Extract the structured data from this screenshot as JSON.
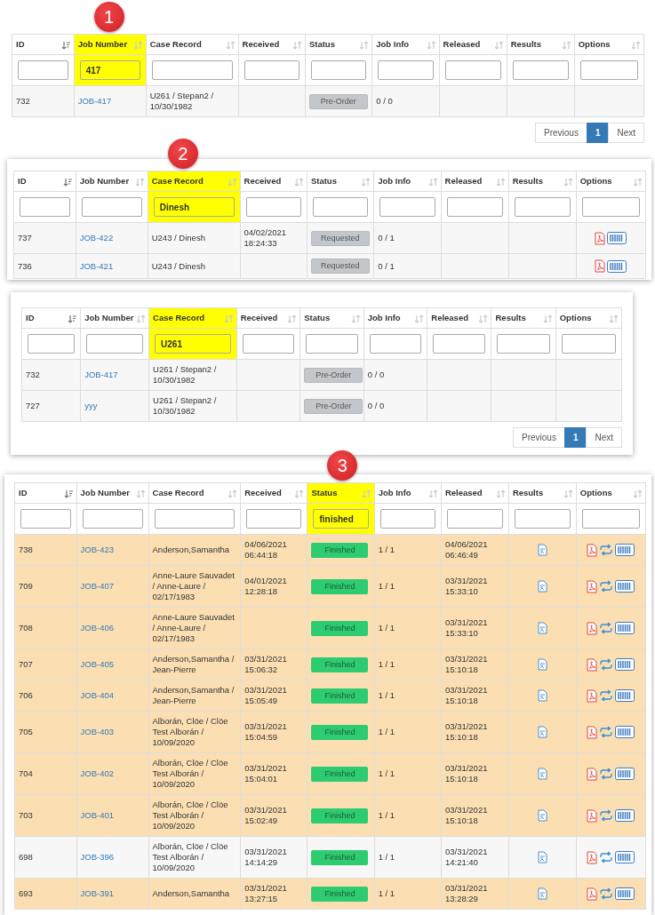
{
  "panels": [
    {
      "badge": "1",
      "columns": [
        {
          "label": "ID",
          "sorted": true,
          "highlighted": false
        },
        {
          "label": "Job Number",
          "sorted": false,
          "highlighted": true,
          "filter": "417"
        },
        {
          "label": "Case Record",
          "sorted": false,
          "highlighted": false
        },
        {
          "label": "Received",
          "sorted": false,
          "highlighted": false
        },
        {
          "label": "Status",
          "sorted": false,
          "highlighted": false
        },
        {
          "label": "Job Info",
          "sorted": false,
          "highlighted": false
        },
        {
          "label": "Released",
          "sorted": false,
          "highlighted": false
        },
        {
          "label": "Results",
          "sorted": false,
          "highlighted": false
        },
        {
          "label": "Options",
          "sorted": false,
          "highlighted": false
        }
      ],
      "rows": [
        {
          "id": "732",
          "job": "JOB-417",
          "case": "U261 / Stepan2 / 10/30/1982",
          "status": {
            "label": "Pre-Order",
            "kind": "pending"
          },
          "job_info": "0 / 0",
          "result_file": false,
          "highlighted": false
        }
      ],
      "pagination": [
        {
          "label": "Previous",
          "selected": false
        },
        {
          "label": "1",
          "selected": true
        },
        {
          "label": "Next",
          "selected": false
        }
      ]
    },
    {
      "badge": "2",
      "columns": [
        {
          "label": "ID",
          "sorted": true,
          "highlighted": false
        },
        {
          "label": "Job Number",
          "sorted": false,
          "highlighted": false
        },
        {
          "label": "Case Record",
          "sorted": false,
          "highlighted": true,
          "filter": "Dinesh"
        },
        {
          "label": "Received",
          "sorted": false,
          "highlighted": false
        },
        {
          "label": "Status",
          "sorted": false,
          "highlighted": false
        },
        {
          "label": "Job Info",
          "sorted": false,
          "highlighted": false
        },
        {
          "label": "Released",
          "sorted": false,
          "highlighted": false
        },
        {
          "label": "Results",
          "sorted": false,
          "highlighted": false
        },
        {
          "label": "Options",
          "sorted": false,
          "highlighted": false
        }
      ],
      "rows": [
        {
          "id": "737",
          "job": "JOB-422",
          "case": "U243 / Dinesh",
          "received": "04/02/2021 18:24:33",
          "status": {
            "label": "Requested",
            "kind": "pending"
          },
          "job_info": "0 / 1",
          "result_file": false,
          "highlighted": false,
          "actions": [
            {
              "kind": "pdf"
            },
            {
              "kind": "barcode"
            }
          ]
        },
        {
          "id": "736",
          "job": "JOB-421",
          "case": "U243 / Dinesh",
          "status": {
            "label": "Requested",
            "kind": "pending"
          },
          "job_info": "0 / 1",
          "result_file": false,
          "highlighted": false,
          "actions": [
            {
              "kind": "pdf"
            },
            {
              "kind": "barcode"
            }
          ]
        }
      ]
    },
    {
      "columns": [
        {
          "label": "ID",
          "sorted": true,
          "highlighted": false
        },
        {
          "label": "Job Number",
          "sorted": false,
          "highlighted": false
        },
        {
          "label": "Case Record",
          "sorted": false,
          "highlighted": true,
          "filter": "U261"
        },
        {
          "label": "Received",
          "sorted": false,
          "highlighted": false
        },
        {
          "label": "Status",
          "sorted": false,
          "highlighted": false
        },
        {
          "label": "Job Info",
          "sorted": false,
          "highlighted": false
        },
        {
          "label": "Released",
          "sorted": false,
          "highlighted": false
        },
        {
          "label": "Results",
          "sorted": false,
          "highlighted": false
        },
        {
          "label": "Options",
          "sorted": false,
          "highlighted": false
        }
      ],
      "rows": [
        {
          "id": "732",
          "job": "JOB-417",
          "case": "U261 / Stepan2 / 10/30/1982",
          "status": {
            "label": "Pre-Order",
            "kind": "pending"
          },
          "job_info": "0 / 0",
          "result_file": false,
          "highlighted": false
        },
        {
          "id": "727",
          "job": "yyy",
          "case": "U261 / Stepan2 / 10/30/1982",
          "status": {
            "label": "Pre-Order",
            "kind": "pending"
          },
          "job_info": "0 / 0",
          "result_file": false,
          "highlighted": false
        }
      ],
      "pagination": [
        {
          "label": "Previous",
          "selected": false
        },
        {
          "label": "1",
          "selected": true
        },
        {
          "label": "Next",
          "selected": false
        }
      ]
    },
    {
      "badge": "3",
      "columns": [
        {
          "label": "ID",
          "sorted": true,
          "highlighted": false
        },
        {
          "label": "Job Number",
          "sorted": false,
          "highlighted": false
        },
        {
          "label": "Case Record",
          "sorted": false,
          "highlighted": false
        },
        {
          "label": "Received",
          "sorted": false,
          "highlighted": false
        },
        {
          "label": "Status",
          "sorted": false,
          "highlighted": true,
          "filter": "finished"
        },
        {
          "label": "Job Info",
          "sorted": false,
          "highlighted": false
        },
        {
          "label": "Released",
          "sorted": false,
          "highlighted": false
        },
        {
          "label": "Results",
          "sorted": false,
          "highlighted": false
        },
        {
          "label": "Options",
          "sorted": false,
          "highlighted": false
        }
      ],
      "rows": [
        {
          "id": "738",
          "job": "JOB-423",
          "case": "Anderson,Samantha",
          "received": "04/06/2021 06:44:18",
          "status": {
            "label": "Finished",
            "kind": "done"
          },
          "job_info": "1 / 1",
          "released": "04/06/2021 06:46:49",
          "result_file": true,
          "highlighted": true,
          "actions": [
            {
              "kind": "pdf"
            },
            {
              "kind": "sync"
            },
            {
              "kind": "barcode"
            }
          ]
        },
        {
          "id": "709",
          "job": "JOB-407",
          "case": "Anne-Laure Sauvadet / Anne-Laure / 02/17/1983",
          "received": "04/01/2021 12:28:18",
          "status": {
            "label": "Finished",
            "kind": "done"
          },
          "job_info": "1 / 1",
          "released": "03/31/2021 15:33:10",
          "result_file": true,
          "highlighted": true,
          "actions": [
            {
              "kind": "pdf"
            },
            {
              "kind": "sync"
            },
            {
              "kind": "barcode"
            }
          ]
        },
        {
          "id": "708",
          "job": "JOB-406",
          "case": "Anne-Laure Sauvadet / Anne-Laure / 02/17/1983",
          "status": {
            "label": "Finished",
            "kind": "done"
          },
          "job_info": "1 / 1",
          "released": "03/31/2021 15:33:10",
          "result_file": true,
          "highlighted": true,
          "actions": [
            {
              "kind": "pdf"
            },
            {
              "kind": "sync"
            },
            {
              "kind": "barcode"
            }
          ]
        },
        {
          "id": "707",
          "job": "JOB-405",
          "case": "Anderson,Samantha / Jean-Pierre",
          "received": "03/31/2021 15:06:32",
          "status": {
            "label": "Finished",
            "kind": "done"
          },
          "job_info": "1 / 1",
          "released": "03/31/2021 15:10:18",
          "result_file": true,
          "highlighted": true,
          "actions": [
            {
              "kind": "pdf"
            },
            {
              "kind": "sync"
            },
            {
              "kind": "barcode"
            }
          ]
        },
        {
          "id": "706",
          "job": "JOB-404",
          "case": "Anderson,Samantha / Jean-Pierre",
          "received": "03/31/2021 15:05:49",
          "status": {
            "label": "Finished",
            "kind": "done"
          },
          "job_info": "1 / 1",
          "released": "03/31/2021 15:10:18",
          "result_file": true,
          "highlighted": true,
          "actions": [
            {
              "kind": "pdf"
            },
            {
              "kind": "sync"
            },
            {
              "kind": "barcode"
            }
          ]
        },
        {
          "id": "705",
          "job": "JOB-403",
          "case": "Alborán, Clöe / Clöe Test Alborán / 10/09/2020",
          "received": "03/31/2021 15:04:59",
          "status": {
            "label": "Finished",
            "kind": "done"
          },
          "job_info": "1 / 1",
          "released": "03/31/2021 15:10:18",
          "result_file": true,
          "highlighted": true,
          "actions": [
            {
              "kind": "pdf"
            },
            {
              "kind": "sync"
            },
            {
              "kind": "barcode"
            }
          ]
        },
        {
          "id": "704",
          "job": "JOB-402",
          "case": "Alborán, Clöe / Clöe Test Alborán / 10/09/2020",
          "received": "03/31/2021 15:04:01",
          "status": {
            "label": "Finished",
            "kind": "done"
          },
          "job_info": "1 / 1",
          "released": "03/31/2021 15:10:18",
          "result_file": true,
          "highlighted": true,
          "actions": [
            {
              "kind": "pdf"
            },
            {
              "kind": "sync"
            },
            {
              "kind": "barcode"
            }
          ]
        },
        {
          "id": "703",
          "job": "JOB-401",
          "case": "Alborán, Clöe / Clöe Test Alborán / 10/09/2020",
          "received": "03/31/2021 15:02:49",
          "status": {
            "label": "Finished",
            "kind": "done"
          },
          "job_info": "1 / 1",
          "released": "03/31/2021 15:10:18",
          "result_file": true,
          "highlighted": true,
          "actions": [
            {
              "kind": "pdf"
            },
            {
              "kind": "sync"
            },
            {
              "kind": "barcode"
            }
          ]
        },
        {
          "id": "698",
          "job": "JOB-396",
          "case": "Alborán, Clöe / Clöe Test Alborán / 10/09/2020",
          "received": "03/31/2021 14:14:29",
          "status": {
            "label": "Finished",
            "kind": "done"
          },
          "job_info": "1 / 1",
          "released": "03/31/2021 14:21:40",
          "result_file": true,
          "highlighted": false,
          "actions": [
            {
              "kind": "pdf"
            },
            {
              "kind": "sync"
            },
            {
              "kind": "barcode"
            }
          ]
        },
        {
          "id": "693",
          "job": "JOB-391",
          "case": "Anderson,Samantha",
          "received": "03/31/2021 13:27:15",
          "status": {
            "label": "Finished",
            "kind": "done"
          },
          "job_info": "1 / 1",
          "released": "03/31/2021 13:28:29",
          "result_file": true,
          "highlighted": true,
          "actions": [
            {
              "kind": "pdf"
            },
            {
              "kind": "sync"
            },
            {
              "kind": "barcode"
            }
          ]
        }
      ]
    }
  ]
}
